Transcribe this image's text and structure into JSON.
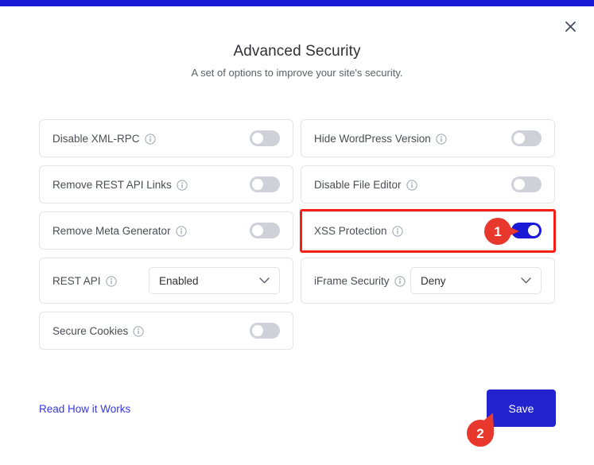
{
  "window": {
    "accent_color": "#1a1ad6",
    "close_icon": "close-icon"
  },
  "header": {
    "title": "Advanced Security",
    "subtitle": "A set of options to improve your site's security."
  },
  "options": {
    "left_column": [
      {
        "label": "Disable XML-RPC",
        "info_icon": "info-circle-icon",
        "control": "toggle",
        "state": "off"
      },
      {
        "label": "Remove REST API Links",
        "info_icon": "info-circle-icon",
        "control": "toggle",
        "state": "off"
      },
      {
        "label": "Remove Meta Generator",
        "info_icon": "info-circle-icon",
        "control": "toggle",
        "state": "off"
      },
      {
        "label": "REST API",
        "info_icon": "info-circle-icon",
        "control": "select",
        "value": "Enabled"
      },
      {
        "label": "Secure Cookies",
        "info_icon": "info-circle-icon",
        "control": "toggle",
        "state": "off"
      }
    ],
    "right_column": [
      {
        "label": "Hide WordPress Version",
        "info_icon": "info-circle-icon",
        "control": "toggle",
        "state": "off"
      },
      {
        "label": "Disable File Editor",
        "info_icon": "info-circle-icon",
        "control": "toggle",
        "state": "off"
      },
      {
        "label": "XSS Protection",
        "info_icon": "info-circle-icon",
        "control": "toggle",
        "state": "on",
        "highlighted": true
      },
      {
        "label": "iFrame Security",
        "info_icon": "info-circle-icon",
        "control": "select",
        "value": "Deny"
      }
    ]
  },
  "annotations": {
    "highlight_color": "#f51f13",
    "marker_color": "#e8372c",
    "markers": [
      {
        "number": "1",
        "target": "xss-protection-toggle"
      },
      {
        "number": "2",
        "target": "save-button"
      }
    ]
  },
  "footer": {
    "read_more_label": "Read How it Works",
    "save_label": "Save",
    "save_color": "#2222cf",
    "link_color": "#3838e0"
  }
}
